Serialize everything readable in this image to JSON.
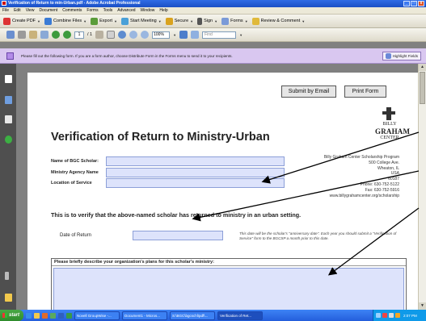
{
  "window": {
    "title": "Verification of Return to min-Urban.pdf - Adobe Acrobat Professional",
    "controls": [
      "_",
      "□",
      "x"
    ]
  },
  "menu": [
    "File",
    "Edit",
    "View",
    "Document",
    "Comments",
    "Forms",
    "Tools",
    "Advanced",
    "Window",
    "Help"
  ],
  "toolbar": {
    "create_pdf": "Create PDF",
    "combine_files": "Combine Files",
    "export": "Export",
    "start_meeting": "Start Meeting",
    "secure": "Secure",
    "sign": "Sign",
    "forms": "Forms",
    "review_comment": "Review & Comment"
  },
  "nav": {
    "page_current": "1",
    "page_total": "/ 1",
    "zoom": "100%",
    "find_placeholder": "Find"
  },
  "message_bar": {
    "text": "Please fill out the following form. If you are a form author, choose Distribute Form in the Forms menu to send it to your recipients.",
    "highlight_button": "Highlight Fields"
  },
  "form": {
    "submit_button": "Submit by Email",
    "print_button": "Print Form",
    "logo": {
      "line1": "BILLY",
      "line2": "GRAHAM",
      "line3": "CENTER"
    },
    "title": "Verification of Return to Ministry-Urban",
    "fields": {
      "scholar_name_label": "Name of BGC Scholar:",
      "agency_label": "Ministry Agency Name",
      "location_label": "Location of Service"
    },
    "address": [
      "Billy Graham Center Scholarship Program",
      "500 College Ave.",
      "Wheaton, IL",
      "USA",
      "60187",
      "Phone: 630-752-5122",
      "Fax: 630-752-5916",
      "www.billygrahamcenter.org/scholarship"
    ],
    "verify_text": "This is to verify that the above-named scholar has returned to ministry in an urban setting.",
    "date_label": "Date of Return",
    "date_note": "This date will be the scholar's \"anniversary date\". Each year you should submit a \"Verification of Service\" form to the BGCSP a month prior to this date.",
    "plans_heading": "Please briefly describe your organization's plans for this scholar's ministry:"
  },
  "taskbar": {
    "start": "start",
    "tasks": [
      "Novell GroupWise -...",
      "Document1 - Micros...",
      "S:\\BGC\\bgcschl\\pdf\\...",
      "Verification of Ret..."
    ],
    "clock": "2:07 PM"
  }
}
